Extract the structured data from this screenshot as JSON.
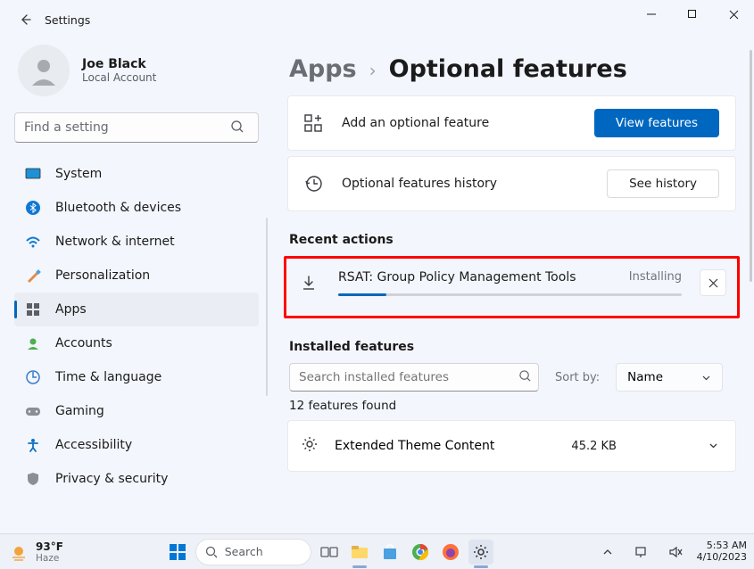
{
  "window": {
    "title": "Settings"
  },
  "profile": {
    "name": "Joe Black",
    "subtitle": "Local Account"
  },
  "search": {
    "placeholder": "Find a setting"
  },
  "nav": {
    "system": "System",
    "bluetooth": "Bluetooth & devices",
    "network": "Network & internet",
    "personalization": "Personalization",
    "apps": "Apps",
    "accounts": "Accounts",
    "time": "Time & language",
    "gaming": "Gaming",
    "accessibility": "Accessibility",
    "privacy": "Privacy & security"
  },
  "breadcrumb": {
    "root": "Apps",
    "current": "Optional features"
  },
  "cards": {
    "add": {
      "label": "Add an optional feature",
      "button": "View features"
    },
    "history": {
      "label": "Optional features history",
      "button": "See history"
    }
  },
  "sections": {
    "recent": "Recent actions",
    "installed": "Installed features"
  },
  "download": {
    "name": "RSAT: Group Policy Management Tools",
    "status": "Installing"
  },
  "filter": {
    "placeholder": "Search installed features",
    "sortLabel": "Sort by:",
    "sortValue": "Name"
  },
  "found": "12 features found",
  "feature0": {
    "name": "Extended Theme Content",
    "size": "45.2 KB"
  },
  "taskbar": {
    "weather": {
      "temp": "93°F",
      "cond": "Haze"
    },
    "search": "Search",
    "clock": {
      "time": "5:53 AM",
      "date": "4/10/2023"
    }
  }
}
